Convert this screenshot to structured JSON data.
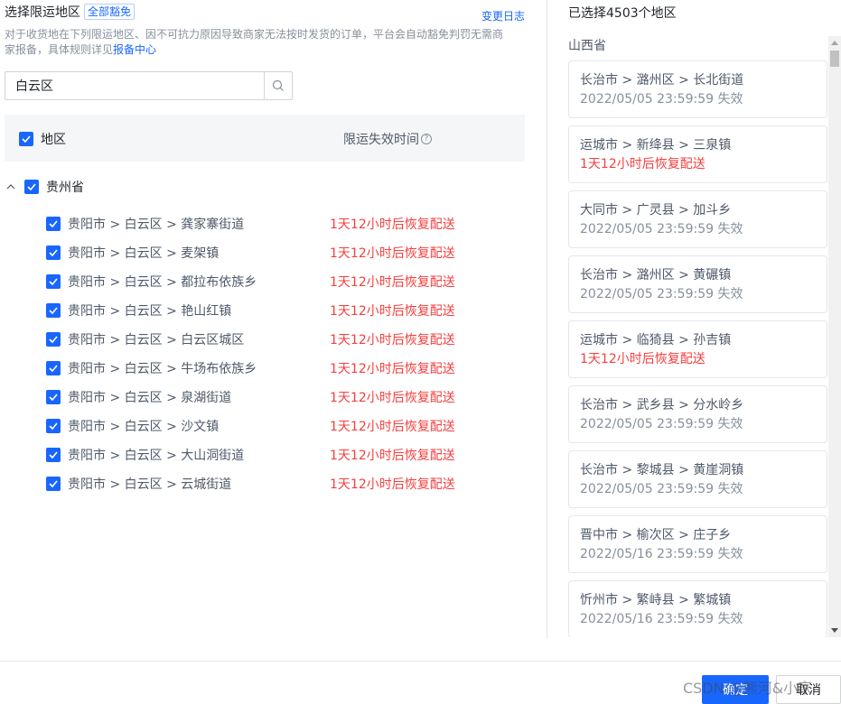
{
  "header": {
    "title": "选择限运地区",
    "tag": "全部豁免",
    "log_link": "变更日志",
    "description": "对于收货地在下列限运地区、因不可抗力原因导致商家无法按时发货的订单，平台会自动豁免判罚无需商家报备，具体规则详见",
    "description_link": "报备中心"
  },
  "search": {
    "value": "白云区"
  },
  "table": {
    "col_region": "地区",
    "col_time": "限运失效时间",
    "province": "贵州省",
    "rows": [
      {
        "name": "贵阳市 > 白云区 > 龚家寨街道",
        "status": "1天12小时后恢复配送"
      },
      {
        "name": "贵阳市 > 白云区 > 麦架镇",
        "status": "1天12小时后恢复配送"
      },
      {
        "name": "贵阳市 > 白云区 > 都拉布依族乡",
        "status": "1天12小时后恢复配送"
      },
      {
        "name": "贵阳市 > 白云区 > 艳山红镇",
        "status": "1天12小时后恢复配送"
      },
      {
        "name": "贵阳市 > 白云区 > 白云区城区",
        "status": "1天12小时后恢复配送"
      },
      {
        "name": "贵阳市 > 白云区 > 牛场布依族乡",
        "status": "1天12小时后恢复配送"
      },
      {
        "name": "贵阳市 > 白云区 > 泉湖街道",
        "status": "1天12小时后恢复配送"
      },
      {
        "name": "贵阳市 > 白云区 > 沙文镇",
        "status": "1天12小时后恢复配送"
      },
      {
        "name": "贵阳市 > 白云区 > 大山洞街道",
        "status": "1天12小时后恢复配送"
      },
      {
        "name": "贵阳市 > 白云区 > 云城街道",
        "status": "1天12小时后恢复配送"
      }
    ]
  },
  "selected": {
    "title": "已选择4503个地区",
    "province": "山西省",
    "items": [
      {
        "path": "长治市 > 潞州区 > 长北街道",
        "sub": "2022/05/05 23:59:59 失效",
        "red": false
      },
      {
        "path": "运城市 > 新绛县 > 三泉镇",
        "sub": "1天12小时后恢复配送",
        "red": true
      },
      {
        "path": "大同市 > 广灵县 > 加斗乡",
        "sub": "2022/05/05 23:59:59 失效",
        "red": false
      },
      {
        "path": "长治市 > 潞州区 > 黄碾镇",
        "sub": "2022/05/05 23:59:59 失效",
        "red": false
      },
      {
        "path": "运城市 > 临猗县 > 孙吉镇",
        "sub": "1天12小时后恢复配送",
        "red": true
      },
      {
        "path": "长治市 > 武乡县 > 分水岭乡",
        "sub": "2022/05/05 23:59:59 失效",
        "red": false
      },
      {
        "path": "长治市 > 黎城县 > 黄崖洞镇",
        "sub": "2022/05/05 23:59:59 失效",
        "red": false
      },
      {
        "path": "晋中市 > 榆次区 > 庄子乡",
        "sub": "2022/05/16 23:59:59 失效",
        "red": false
      },
      {
        "path": "忻州市 > 繁峙县 > 繁城镇",
        "sub": "2022/05/16 23:59:59 失效",
        "red": false
      }
    ]
  },
  "footer": {
    "ok": "确定",
    "cancel": "取消"
  },
  "watermark": "CSDN @熊河&小家",
  "colors": {
    "accent": "#1966ff",
    "danger": "#f53f3f"
  }
}
